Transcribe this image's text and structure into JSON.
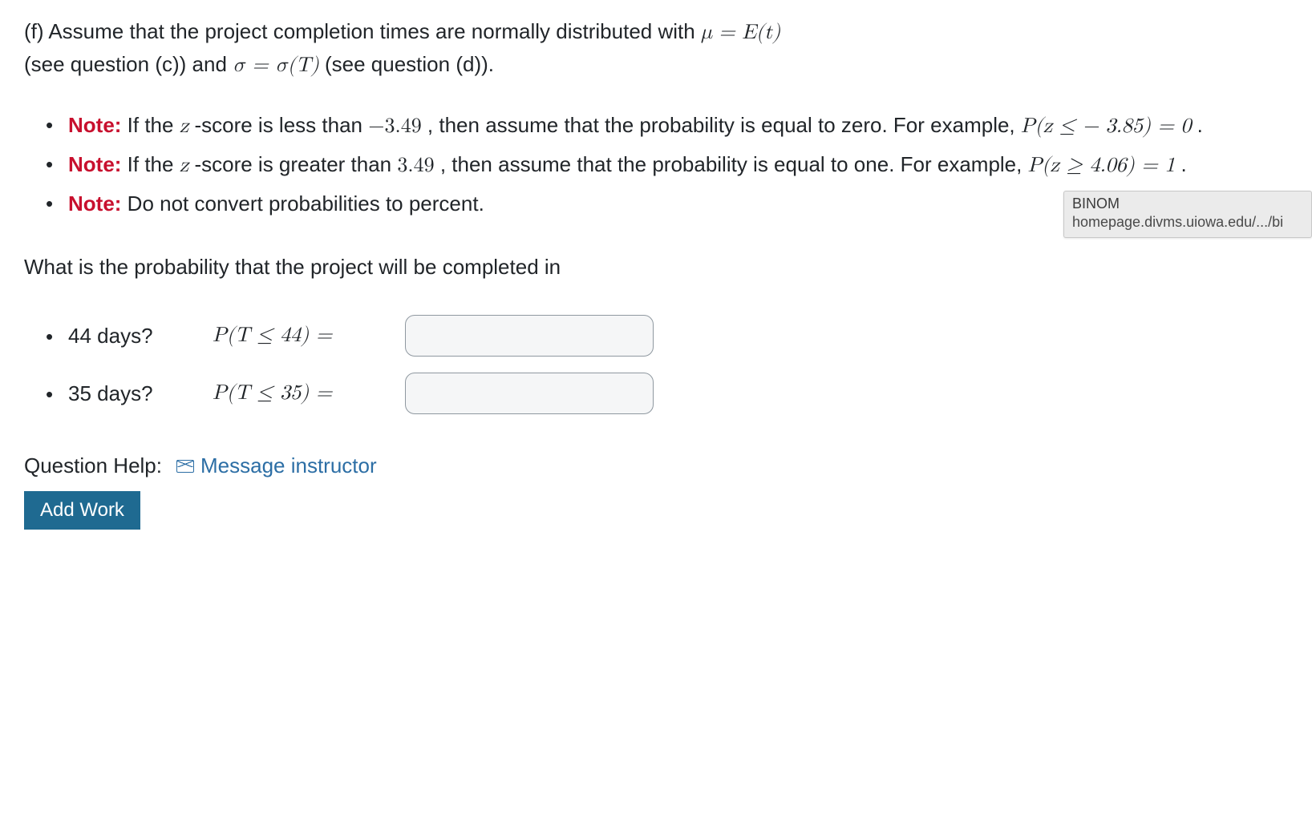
{
  "intro": {
    "part_label": "(f) ",
    "line1_pre": "Assume that the project completion times are normally distributed with ",
    "line1_math": "μ = E(t)",
    "line2_pre": "(see question (c)) and ",
    "line2_math": "σ = σ(T)",
    "line2_post": " (see question (d))."
  },
  "notes": {
    "note_label": "Note:",
    "items": [
      {
        "text_pre": " If the ",
        "z_var": "z",
        "text_mid1": " -score is less than ",
        "math1": "−3.49",
        "text_mid2": " , then assume that the probability is equal to zero. For example, ",
        "math2": "P(z ≤  − 3.85) = 0",
        "text_post": " ."
      },
      {
        "text_pre": " If the ",
        "z_var": "z",
        "text_mid1": " -score is greater than ",
        "math1": "3.49",
        "text_mid2": " , then assume that the probability is equal to one. For example, ",
        "math2": "P(z ≥ 4.06) = 1",
        "text_post": " ."
      },
      {
        "text_pre": " Do not convert probabilities to percent."
      }
    ]
  },
  "question": "What is the probability that the project will be completed in",
  "answers": [
    {
      "days_label": "44 days?",
      "expr": "P(T ≤ 44) =",
      "value": ""
    },
    {
      "days_label": "35 days?",
      "expr": "P(T ≤ 35) =",
      "value": ""
    }
  ],
  "help": {
    "label": "Question Help:",
    "link_text": "Message instructor"
  },
  "buttons": {
    "add_work": "Add Work"
  },
  "tooltip": {
    "title": "BINOM",
    "subtitle": "homepage.divms.uiowa.edu/.../bi"
  }
}
